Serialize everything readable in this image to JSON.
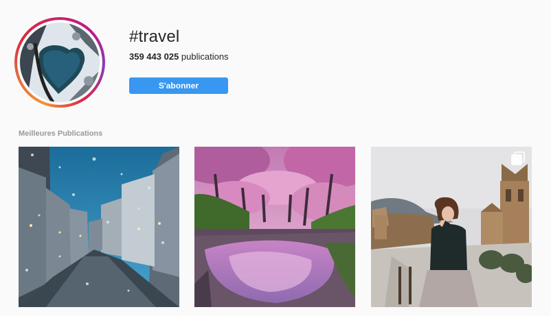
{
  "header": {
    "hashtag": "#travel",
    "post_count": "359 443 025",
    "post_count_suffix": " publications",
    "follow_label": "S'abonner"
  },
  "top_posts": {
    "section_label": "Meilleures Publications",
    "posts": [
      {
        "name": "post-snowy-street",
        "icon": null
      },
      {
        "name": "post-cherry-blossom-path",
        "icon": null
      },
      {
        "name": "post-woman-old-town",
        "icon": "carousel-icon"
      }
    ]
  },
  "colors": {
    "follow_button": "#3897f0",
    "background": "#fafafa",
    "label_gray": "#999999"
  }
}
